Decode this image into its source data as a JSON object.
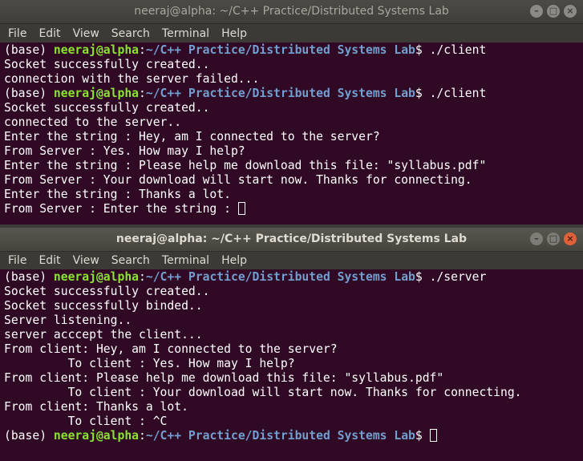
{
  "top_window": {
    "title": "neeraj@alpha: ~/C++ Practice/Distributed Systems Lab",
    "menu": [
      "File",
      "Edit",
      "View",
      "Search",
      "Terminal",
      "Help"
    ],
    "lines": [
      {
        "prompt": true,
        "env": "(base) ",
        "user": "neeraj@alpha",
        "sep": ":",
        "path": "~/C++ Practice/Distributed Systems Lab",
        "end": "$ ./client"
      },
      {
        "text": "Socket successfully created.."
      },
      {
        "text": "connection with the server failed..."
      },
      {
        "prompt": true,
        "env": "(base) ",
        "user": "neeraj@alpha",
        "sep": ":",
        "path": "~/C++ Practice/Distributed Systems Lab",
        "end": "$ ./client"
      },
      {
        "text": "Socket successfully created.."
      },
      {
        "text": "connected to the server.."
      },
      {
        "text": "Enter the string : Hey, am I connected to the server?"
      },
      {
        "text": "From Server : Yes. How may I help?"
      },
      {
        "text": "Enter the string : Please help me download this file: \"syllabus.pdf\""
      },
      {
        "text": "From Server : Your download will start now. Thanks for connecting."
      },
      {
        "text": "Enter the string : Thanks a lot."
      },
      {
        "text": "From Server : Enter the string : ",
        "cursor": true
      }
    ]
  },
  "bottom_window": {
    "title": "neeraj@alpha: ~/C++ Practice/Distributed Systems Lab",
    "menu": [
      "File",
      "Edit",
      "View",
      "Search",
      "Terminal",
      "Help"
    ],
    "lines": [
      {
        "prompt": true,
        "env": "(base) ",
        "user": "neeraj@alpha",
        "sep": ":",
        "path": "~/C++ Practice/Distributed Systems Lab",
        "end": "$ ./server"
      },
      {
        "text": "Socket successfully created.."
      },
      {
        "text": "Socket successfully binded.."
      },
      {
        "text": "Server listening.."
      },
      {
        "text": "server acccept the client..."
      },
      {
        "text": "From client: Hey, am I connected to the server?"
      },
      {
        "text": "         To client : Yes. How may I help?"
      },
      {
        "text": "From client: Please help me download this file: \"syllabus.pdf\""
      },
      {
        "text": "         To client : Your download will start now. Thanks for connecting."
      },
      {
        "text": "From client: Thanks a lot."
      },
      {
        "text": "         To client : ^C"
      },
      {
        "prompt": true,
        "env": "(base) ",
        "user": "neeraj@alpha",
        "sep": ":",
        "path": "~/C++ Practice/Distributed Systems Lab",
        "end": "$ ",
        "cursor": true
      }
    ]
  },
  "window_buttons": {
    "minimize": "–",
    "maximize": "□",
    "close": "×"
  },
  "colors": {
    "terminal_bg": "#300a24",
    "user": "#8ae234",
    "path": "#729fcf",
    "text": "#ffffff"
  }
}
